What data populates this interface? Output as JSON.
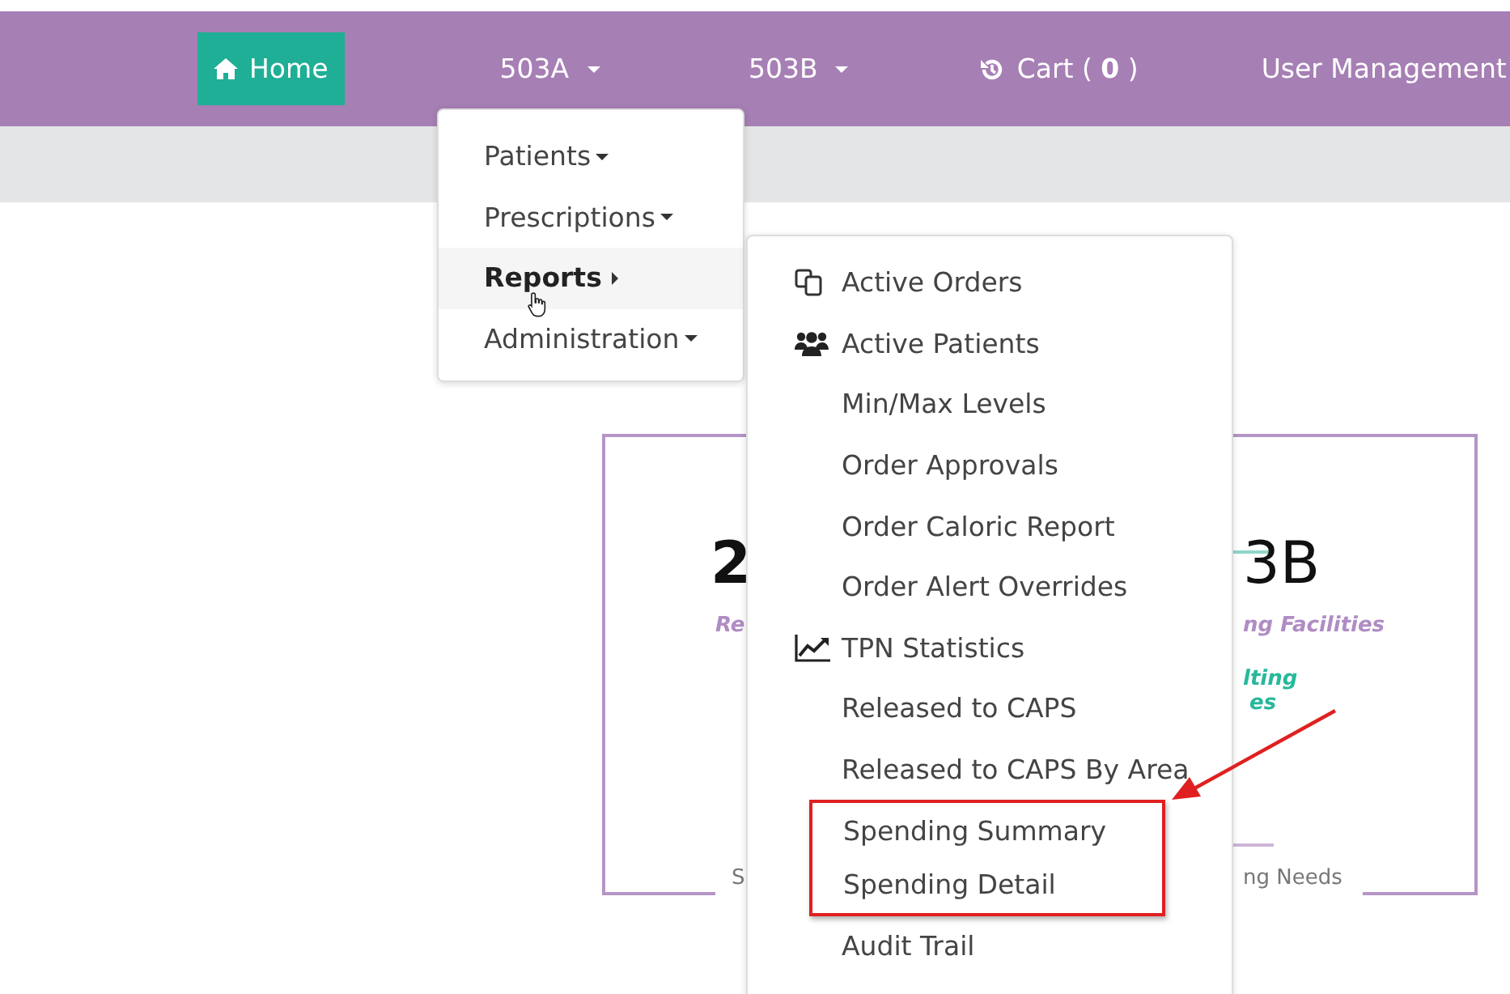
{
  "navbar": {
    "items": [
      {
        "label": "Home",
        "kind": "home",
        "selected": true
      },
      {
        "label": "503A",
        "kind": "dropdown",
        "selected": false
      },
      {
        "label": "503B",
        "kind": "dropdown",
        "selected": false
      },
      {
        "label": "Cart ( **0** )",
        "kind": "cart",
        "selected": false
      },
      {
        "label": "User Management",
        "kind": "link",
        "selected": false
      }
    ]
  },
  "menu": {
    "items": [
      {
        "label": "Patients",
        "kind": "dropdown",
        "selected": false
      },
      {
        "label": "Prescriptions",
        "kind": "dropdown",
        "selected": false
      },
      {
        "label": "Reports",
        "kind": "submenu",
        "selected": true
      },
      {
        "label": "Administration",
        "kind": "dropdown",
        "selected": false
      }
    ]
  },
  "submenu": {
    "items": [
      {
        "label": "Active Orders",
        "kind": "orders",
        "highlighted": false
      },
      {
        "label": "Active Patients",
        "kind": "patients",
        "highlighted": false
      },
      {
        "label": "Min/Max Levels",
        "highlighted": false
      },
      {
        "label": "Order Approvals",
        "highlighted": false
      },
      {
        "label": "Order Caloric Report",
        "highlighted": false
      },
      {
        "label": "Order Alert Overrides",
        "highlighted": false
      },
      {
        "label": "TPN Statistics",
        "kind": "chart",
        "highlighted": false
      },
      {
        "label": "Released to CAPS",
        "highlighted": false
      },
      {
        "label": "Released to CAPS By Area",
        "highlighted": false
      },
      {
        "label": "Spending Summary",
        "highlighted": true
      },
      {
        "label": "Spending Detail",
        "highlighted": true
      },
      {
        "label": "Audit Trail",
        "highlighted": false
      }
    ]
  },
  "card": {
    "texts": [
      {
        "text": "2",
        "kind": "number"
      },
      {
        "text": "Re",
        "kind": "caption"
      },
      {
        "text": "3B",
        "kind": "number"
      },
      {
        "text": "ng Facilities",
        "kind": "caption"
      },
      {
        "text": "lting",
        "kind": "accent"
      },
      {
        "text": "es",
        "kind": "accent"
      },
      {
        "text": "S",
        "kind": "footer"
      },
      {
        "text": "ng Needs",
        "kind": "footer"
      }
    ]
  }
}
